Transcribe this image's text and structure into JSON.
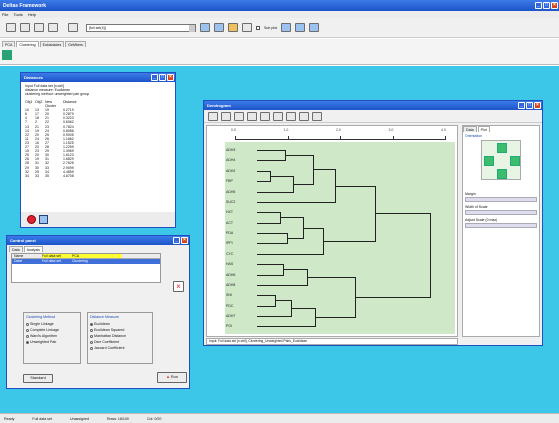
{
  "app": {
    "title": "Deltas Framework",
    "menu": [
      "File",
      "Tools",
      "Help"
    ],
    "dataset_select": "[full set(4)]",
    "checkbox_label": "Sub plot",
    "tabs": [
      "PCA",
      "Clustering",
      "Euklankdes",
      "GeMbers"
    ]
  },
  "distances": {
    "title": "Distances",
    "header_lines": [
      "Input Full data set [n:cell]",
      "distance measure: Euclidean",
      "clustering method: unweighted pair group"
    ],
    "col_headers": [
      "Obj1",
      "Obj2",
      "New Cluster",
      "Distance"
    ],
    "rows": [
      [
        "10",
        "13",
        "19",
        "0.2719"
      ],
      [
        "6",
        "17",
        "20",
        "0.2879"
      ],
      [
        "4",
        "18",
        "21",
        "0.3223"
      ],
      [
        "7",
        "2",
        "22",
        "0.6062"
      ],
      [
        "13",
        "21",
        "23",
        "0.7824"
      ],
      [
        "14",
        "19",
        "24",
        "0.8086"
      ],
      [
        "22",
        "20",
        "25",
        "0.9005"
      ],
      [
        "11",
        "24",
        "26",
        "1.1662"
      ],
      [
        "23",
        "16",
        "27",
        "1.1525"
      ],
      [
        "27",
        "20",
        "28",
        "1.2259"
      ],
      [
        "15",
        "23",
        "29",
        "1.3969"
      ],
      [
        "25",
        "20",
        "30",
        "1.6123"
      ],
      [
        "26",
        "19",
        "31",
        "1.6829"
      ],
      [
        "28",
        "31",
        "32",
        "2.7625"
      ],
      [
        "29",
        "30",
        "33",
        "2.9099"
      ],
      [
        "32",
        "25",
        "34",
        "4.4859"
      ],
      [
        "34",
        "33",
        "35",
        "4.6708"
      ]
    ]
  },
  "control": {
    "title": "Control panel",
    "tabs": [
      "Data",
      "Analysis"
    ],
    "table_headers": [
      "Name",
      "Full data set",
      "PCA"
    ],
    "table_row": [
      "Datei",
      "Full data set",
      "Clustering"
    ],
    "clustering_method": {
      "title": "Clustering Method",
      "options": [
        "Single Linkage",
        "Complete Linkage",
        "Ward's Algorithm",
        "Unweighted Pair"
      ],
      "selected": 3
    },
    "distance_measure": {
      "title": "Distance Measure",
      "options": [
        "Euclidean",
        "Euclidean Squared",
        "Manhattan Distance",
        "Dice Coefficient",
        "Jaccard Coefficient"
      ],
      "selected": 0
    },
    "standard_label": "Standard",
    "run_label": "Run"
  },
  "dendrogram": {
    "title": "Dendrogram",
    "axis_ticks": [
      "0.0",
      "1.0",
      "2.0",
      "3.0",
      "4.0"
    ],
    "leaves": [
      "ADH3",
      "ADH4",
      "ADH2",
      "FBP",
      "ADH5",
      "SUC2",
      "HXT",
      "ACT",
      "PDA",
      "IPPI",
      "CYC",
      "HAS",
      "ADH6",
      "ADH8",
      "SNI",
      "PDC",
      "ADH7",
      "PGI"
    ],
    "status": "Input: Full data set [n:cell], Clustering_Unweighted Pairs_Euclidean",
    "side_tabs": [
      "Data",
      "Plot"
    ],
    "orientation_label": "Orientation",
    "margin_label": "Margin",
    "width_label": "Width of Scale",
    "adjust_label": "Adjust Scale (0 max)"
  },
  "statusbar": {
    "items": [
      "Ready",
      "Full data set",
      "Unassigned",
      "Rows: 18/100",
      "Col: 0/20"
    ]
  }
}
